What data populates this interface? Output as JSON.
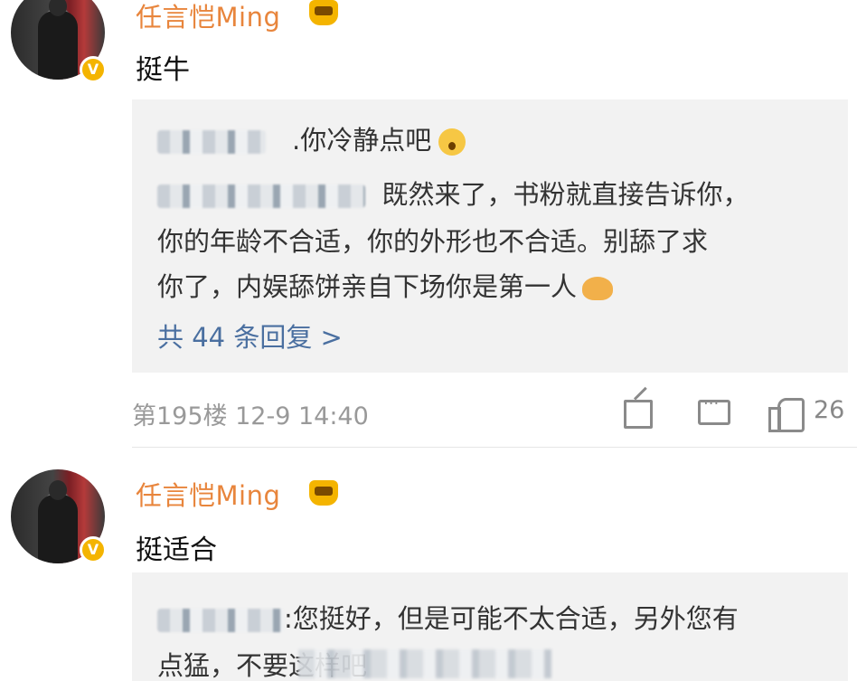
{
  "comments": [
    {
      "username": "任言恺Ming",
      "verified_badge": "V",
      "text": "挺牛",
      "replies": [
        {
          "visible_text": "　.你冷静点吧"
        },
        {
          "visible_text": "既然来了，书粉就直接告诉你，"
        },
        {
          "visible_text": "你的年龄不合适，你的外形也不合适。别舔了求"
        },
        {
          "visible_text": "你了，内娱舔饼亲自下场你是第一人"
        }
      ],
      "more_replies": "共 44 条回复 >",
      "floor_and_time": "第195楼 12-9 14:40",
      "like_count": "26"
    },
    {
      "username": "任言恺Ming",
      "verified_badge": "V",
      "text": "挺适合",
      "replies": [
        {
          "visible_text": ":您挺好，但是可能不太合适，另外您有"
        },
        {
          "visible_text": "点猛，不要这样吧"
        }
      ]
    }
  ],
  "icons": {
    "crown": "crown-icon",
    "share": "share-icon",
    "comment": "comment-icon",
    "like": "like-icon",
    "surprised_emoji": "surprised-icon",
    "clap_emoji": "clap-icon"
  },
  "colors": {
    "username": "#e8853c",
    "link": "#4a6fa0",
    "reply_bg": "#f2f2f2",
    "meta": "#999999"
  }
}
